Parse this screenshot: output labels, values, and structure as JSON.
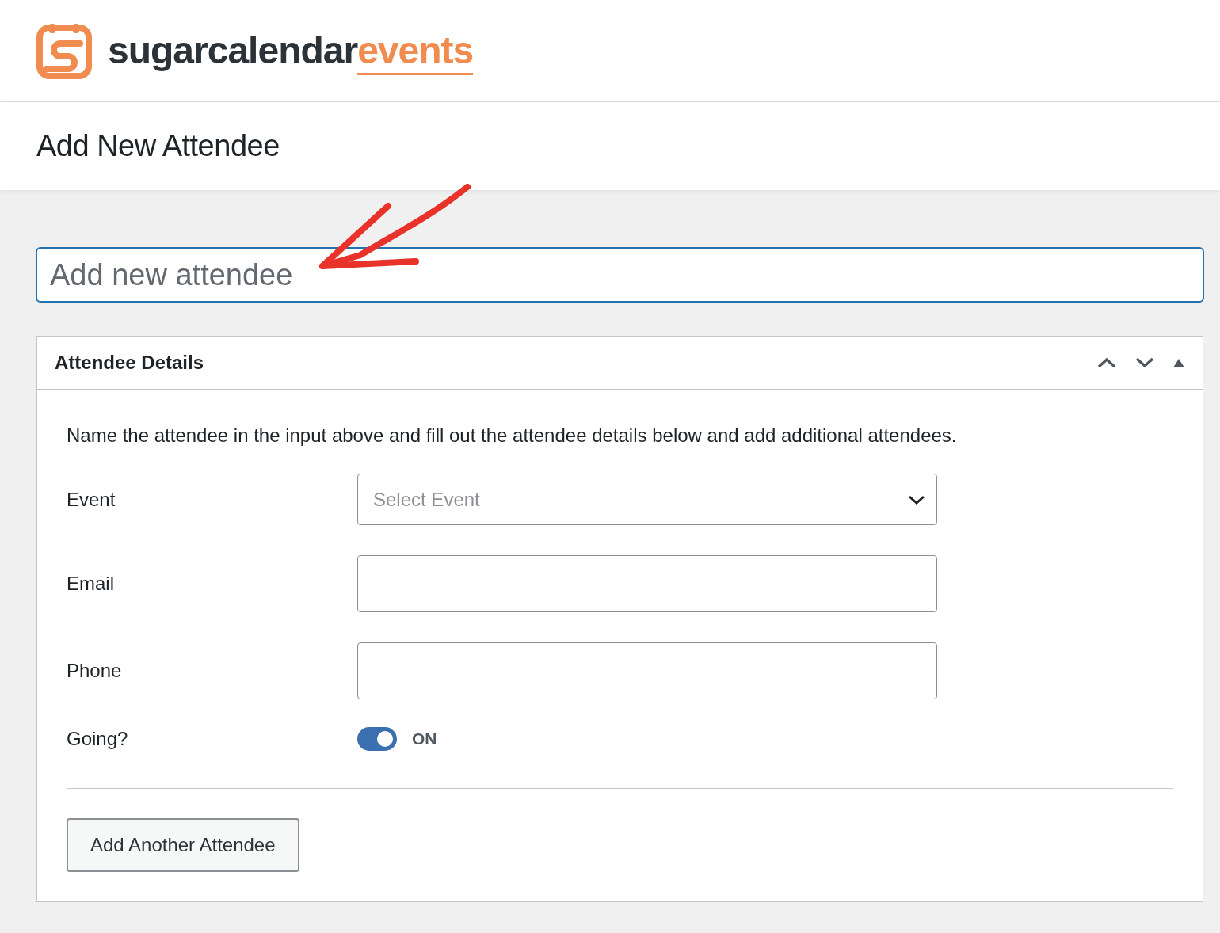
{
  "logo": {
    "name": "sugarcalendar",
    "suffix": "events"
  },
  "page_title": "Add New Attendee",
  "title_field": {
    "placeholder": "Add new attendee"
  },
  "panel": {
    "title": "Attendee Details",
    "expanded": true,
    "description": "Name the attendee in the input above and fill out the attendee details below and add additional attendees.",
    "fields": [
      {
        "kind": "select",
        "label": "Event",
        "placeholder": "Select Event"
      },
      {
        "kind": "text",
        "label": "Email"
      },
      {
        "kind": "text",
        "label": "Phone"
      },
      {
        "kind": "toggle",
        "label": "Going?",
        "on": true,
        "state_label": "ON"
      }
    ],
    "button": "Add Another Attendee"
  }
}
